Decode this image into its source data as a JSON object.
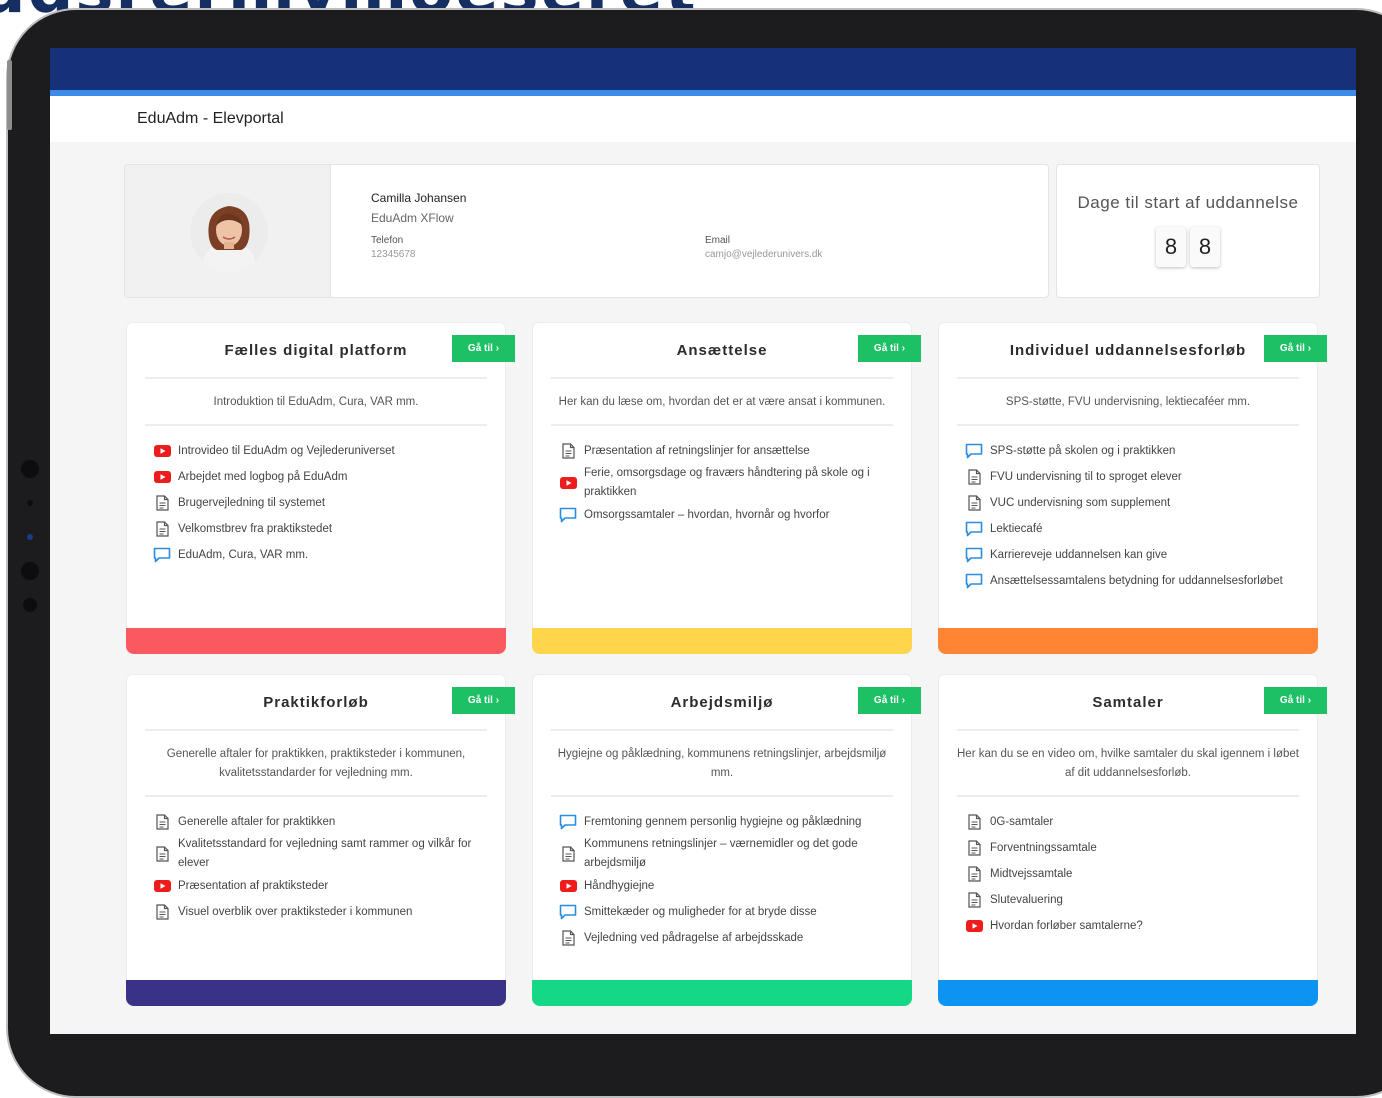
{
  "heading_clipped": "udsrermymoeseret",
  "app": {
    "title": "EduAdm - Elevportal"
  },
  "profile": {
    "name": "Camilla Johansen",
    "org": "EduAdm XFlow",
    "phone_label": "Telefon",
    "phone": "12345678",
    "email_label": "Email",
    "email": "camjo@vejlederunivers.dk"
  },
  "countdown": {
    "title": "Dage til start af uddannelse",
    "digits": [
      "8",
      "8"
    ]
  },
  "goto_label": "Gå til",
  "colors": {
    "topbar": "#16307a",
    "accent_line": "#3d8be8",
    "goto": "#1ec065"
  },
  "cards": [
    {
      "title": "Fælles digital platform",
      "desc": "Introduktion til EduAdm, Cura, VAR  mm.",
      "bar_color": "#fa5a5f",
      "items": [
        {
          "icon": "youtube-icon",
          "text": "Introvideo til EduAdm og Vejlederuniverset"
        },
        {
          "icon": "youtube-icon",
          "text": "Arbejdet med logbog på EduAdm"
        },
        {
          "icon": "document-icon",
          "text": "Brugervejledning til systemet"
        },
        {
          "icon": "document-icon",
          "text": "Velkomstbrev fra praktikstedet"
        },
        {
          "icon": "chat-icon",
          "text": "EduAdm, Cura, VAR mm."
        }
      ]
    },
    {
      "title": "Ansættelse",
      "desc": "Her kan du læse om, hvordan det er at være ansat i kommunen.",
      "bar_color": "#ffd54a",
      "items": [
        {
          "icon": "document-icon",
          "text": "Præsentation af retningslinjer for ansættelse"
        },
        {
          "icon": "youtube-icon",
          "text": "Ferie, omsorgsdage og fraværs håndtering på skole og i praktikken"
        },
        {
          "icon": "chat-icon",
          "text": "Omsorgssamtaler – hvordan, hvornår og hvorfor"
        }
      ]
    },
    {
      "title": "Individuel uddannelsesforløb",
      "desc": "SPS-støtte, FVU undervisning, lektiecaféer mm.",
      "bar_color": "#ff8534",
      "items": [
        {
          "icon": "chat-icon",
          "text": "SPS-støtte på skolen og i praktikken"
        },
        {
          "icon": "document-icon",
          "text": "FVU undervisning til to sproget elever"
        },
        {
          "icon": "document-icon",
          "text": "VUC undervisning som supplement"
        },
        {
          "icon": "chat-icon",
          "text": "Lektiecafé"
        },
        {
          "icon": "chat-icon",
          "text": "Karriereveje uddannelsen kan give"
        },
        {
          "icon": "chat-icon",
          "text": "Ansættelsessamtalens betydning for uddannelsesforløbet"
        }
      ]
    },
    {
      "title": "Praktikforløb",
      "desc": "Generelle aftaler for praktikken, praktiksteder i kommunen, kvalitetsstandarder for vejledning mm.",
      "bar_color": "#3a3286",
      "items": [
        {
          "icon": "document-icon",
          "text": "Generelle aftaler for praktikken"
        },
        {
          "icon": "document-icon",
          "text": "Kvalitetsstandard for vejledning samt rammer og vilkår for elever"
        },
        {
          "icon": "youtube-icon",
          "text": "Præsentation af praktiksteder"
        },
        {
          "icon": "document-icon",
          "text": "Visuel overblik over praktiksteder i kommunen"
        }
      ]
    },
    {
      "title": "Arbejdsmiljø",
      "desc": "Hygiejne og påklædning, kommunens retningslinjer, arbejdsmiljø mm.",
      "bar_color": "#14d885",
      "items": [
        {
          "icon": "chat-icon",
          "text": "Fremtoning gennem personlig hygiejne og påklædning"
        },
        {
          "icon": "document-icon",
          "text": "Kommunens retningslinjer – værnemidler og det gode arbejdsmiljø"
        },
        {
          "icon": "youtube-icon",
          "text": "Håndhygiejne"
        },
        {
          "icon": "chat-icon",
          "text": "Smittekæder og muligheder for at bryde disse"
        },
        {
          "icon": "document-icon",
          "text": "Vejledning ved pådragelse af arbejdsskade"
        }
      ]
    },
    {
      "title": "Samtaler",
      "desc": "Her kan du se en video om, hvilke samtaler du skal igennem i løbet af dit uddannelsesforløb.",
      "bar_color": "#0d94f2",
      "items": [
        {
          "icon": "document-icon",
          "text": "0G-samtaler"
        },
        {
          "icon": "document-icon",
          "text": "Forventningssamtale"
        },
        {
          "icon": "document-icon",
          "text": "Midtvejssamtale"
        },
        {
          "icon": "document-icon",
          "text": "Slutevaluering"
        },
        {
          "icon": "youtube-icon",
          "text": "Hvordan forløber samtalerne?"
        }
      ]
    }
  ]
}
